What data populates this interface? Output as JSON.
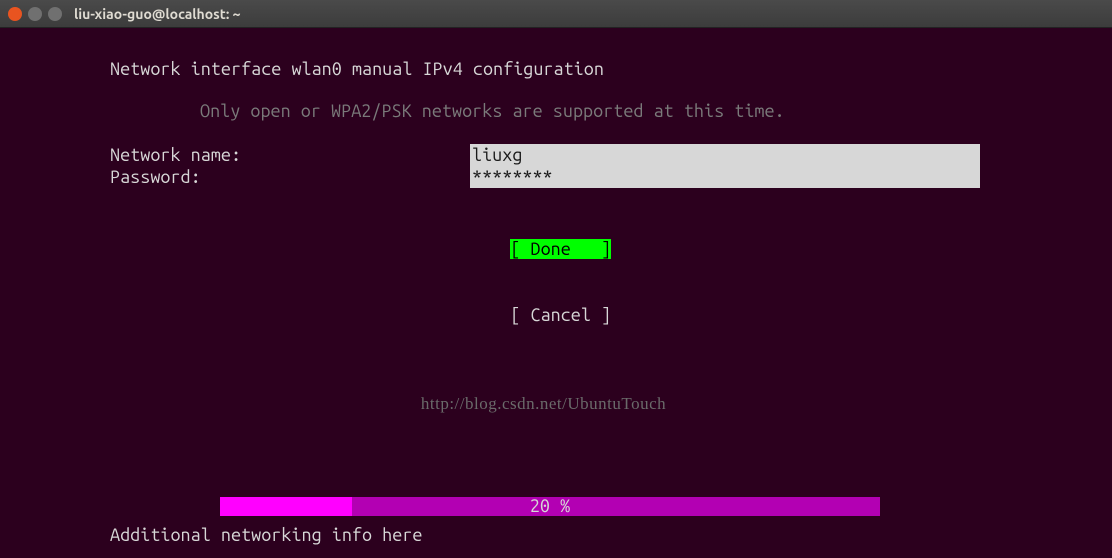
{
  "window": {
    "title": "liu-xiao-guo@localhost: ~"
  },
  "header": {
    "title": "Network interface wlan0 manual IPv4 configuration",
    "subtitle": "Only open or WPA2/PSK networks are supported at this time."
  },
  "form": {
    "network_name_label": "Network name:",
    "network_name_value": "liuxg",
    "password_label": "Password:",
    "password_value": "********"
  },
  "buttons": {
    "done_label": "[ Done   ]",
    "cancel_label": "[ Cancel ]"
  },
  "watermark": {
    "text": "http://blog.csdn.net/UbuntuTouch"
  },
  "progress": {
    "percent_text": "20 %",
    "percent_value": 20
  },
  "footer": {
    "text": "Additional networking info here"
  }
}
